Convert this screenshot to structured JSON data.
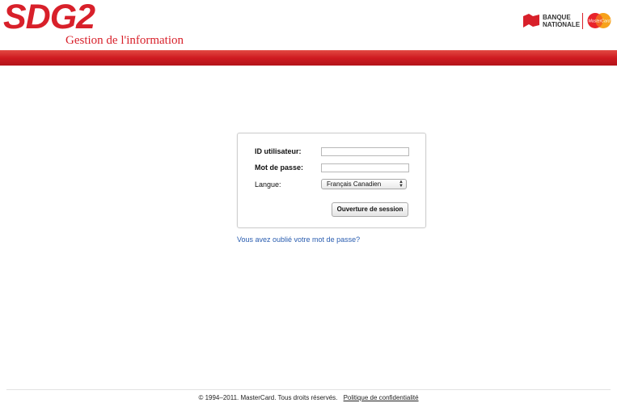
{
  "header": {
    "logo_text": "SDG2",
    "logo_subtitle": "Gestion de l'information",
    "bank_line1": "BANQUE",
    "bank_line2": "NATIONALE",
    "mastercard_text": "MasterCard"
  },
  "colors": {
    "brand_red": "#d8202a",
    "link_blue": "#2a5db0"
  },
  "login": {
    "user_label": "ID utilisateur:",
    "user_value": "",
    "password_label": "Mot de passe:",
    "password_value": "",
    "language_label": "Langue:",
    "language_selected": "Français Canadien",
    "submit_label": "Ouverture de session"
  },
  "forgot_password": "Vous avez oublié votre mot de passe?",
  "footer": {
    "copyright": "© 1994–2011. MasterCard. Tous droits réservés.",
    "privacy_link": "Politique de confidentialité"
  }
}
